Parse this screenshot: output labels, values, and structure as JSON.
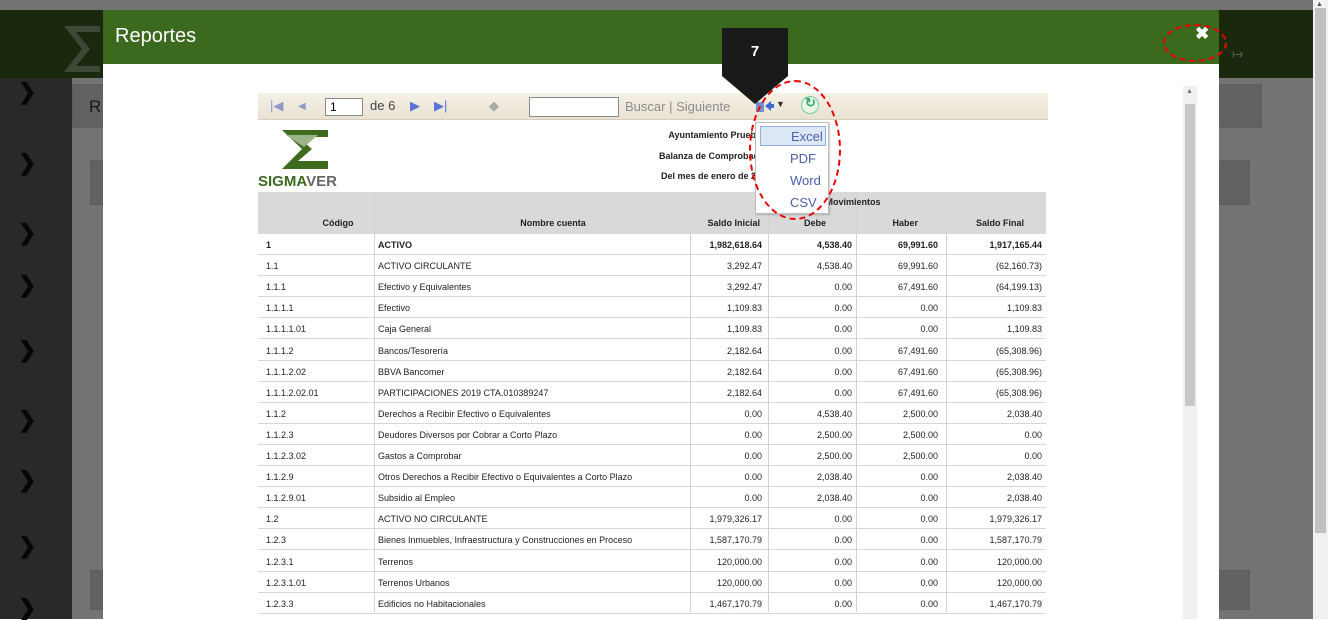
{
  "app": {
    "background_panel_letter": "R"
  },
  "modal": {
    "title": "Reportes",
    "close_icon": "close-icon"
  },
  "annotation": {
    "step_number": "7"
  },
  "toolbar": {
    "page_value": "1",
    "page_of": "de 6",
    "find_text": "Buscar",
    "separator": "|",
    "next_text": "Siguiente"
  },
  "export_menu": {
    "items": [
      "Excel",
      "PDF",
      "Word",
      "CSV"
    ],
    "selected": "Excel"
  },
  "report": {
    "logo_text_1": "SIGMA",
    "logo_text_2": "VER",
    "header_line_1": "Ayuntamiento Prueba",
    "header_line_2": "Balanza de Comprobaci",
    "header_line_3": "Del mes de enero de 20",
    "group_header": "Movimientos",
    "columns": [
      "Código",
      "Nombre cuenta",
      "Saldo Inicial",
      "Debe",
      "Haber",
      "Saldo Final"
    ],
    "rows": [
      [
        "1",
        "ACTIVO",
        "1,982,618.64",
        "4,538.40",
        "69,991.60",
        "1,917,165.44"
      ],
      [
        "1.1",
        "ACTIVO CIRCULANTE",
        "3,292.47",
        "4,538.40",
        "69,991.60",
        "(62,160.73)"
      ],
      [
        "1.1.1",
        "Efectivo y Equivalentes",
        "3,292.47",
        "0.00",
        "67,491.60",
        "(64,199.13)"
      ],
      [
        "1.1.1.1",
        "Efectivo",
        "1,109.83",
        "0.00",
        "0.00",
        "1,109.83"
      ],
      [
        "1.1.1.1.01",
        "Caja General",
        "1,109.83",
        "0.00",
        "0.00",
        "1,109.83"
      ],
      [
        "1.1.1.2",
        "Bancos/Tesorería",
        "2,182.64",
        "0.00",
        "67,491.60",
        "(65,308.96)"
      ],
      [
        "1.1.1.2.02",
        "BBVA Bancomer",
        "2,182.64",
        "0.00",
        "67,491.60",
        "(65,308.96)"
      ],
      [
        "1.1.1.2.02.01",
        "PARTICIPACIONES 2019 CTA.010389247",
        "2,182.64",
        "0.00",
        "67,491.60",
        "(65,308.96)"
      ],
      [
        "1.1.2",
        "Derechos a Recibir Efectivo o Equivalentes",
        "0.00",
        "4,538.40",
        "2,500.00",
        "2,038.40"
      ],
      [
        "1.1.2.3",
        "Deudores Diversos por Cobrar a Corto Plazo",
        "0.00",
        "2,500.00",
        "2,500.00",
        "0.00"
      ],
      [
        "1.1.2.3.02",
        "Gastos a Comprobar",
        "0.00",
        "2,500.00",
        "2,500.00",
        "0.00"
      ],
      [
        "1.1.2.9",
        "Otros Derechos a Recibir Efectivo o Equivalentes a Corto Plazo",
        "0.00",
        "2,038.40",
        "0.00",
        "2,038.40"
      ],
      [
        "1.1.2.9.01",
        "Subsidio al Empleo",
        "0.00",
        "2,038.40",
        "0.00",
        "2,038.40"
      ],
      [
        "1.2",
        "ACTIVO NO CIRCULANTE",
        "1,979,326.17",
        "0.00",
        "0.00",
        "1,979,326.17"
      ],
      [
        "1.2.3",
        "Bienes Inmuebles, Infraestructura y Construcciones en Proceso",
        "1,587,170.79",
        "0.00",
        "0.00",
        "1,587,170.79"
      ],
      [
        "1.2.3.1",
        "Terrenos",
        "120,000.00",
        "0.00",
        "0.00",
        "120,000.00"
      ],
      [
        "1.2.3.1.01",
        "Terrenos Urbanos",
        "120,000.00",
        "0.00",
        "0.00",
        "120,000.00"
      ],
      [
        "1.2.3.3",
        "Edificios no Habitacionales",
        "1,467,170.79",
        "0.00",
        "0.00",
        "1,467,170.79"
      ]
    ]
  }
}
